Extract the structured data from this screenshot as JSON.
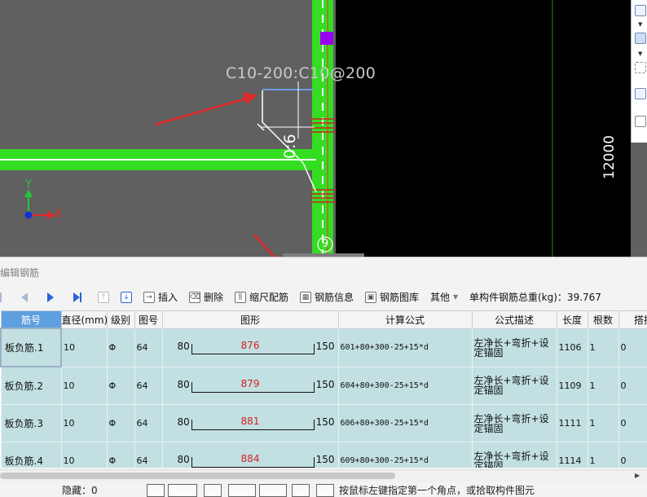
{
  "cad": {
    "rebar_label": "C10-200:C10@200",
    "length_label": "12000",
    "dim_label": "0:6",
    "grid_circle_label": "9",
    "axis_x": "X",
    "axis_y": "Y",
    "colors": {
      "beam": "#33dd22",
      "viewport_bg": "#606060",
      "black_area": "#000000",
      "rebar_red": "#cc2222",
      "arrow_red": "#e02828"
    }
  },
  "panel": {
    "title": "编辑钢筋",
    "toolbar": {
      "insert_label": "插入",
      "delete_label": "删除",
      "scale_label": "缩尺配筋",
      "rebar_info_label": "钢筋信息",
      "rebar_library_label": "钢筋图库",
      "other_label": "其他",
      "total_weight_label": "单构件钢筋总重(kg)：39.767"
    },
    "columns": [
      "筋号",
      "直径(mm)",
      "级别",
      "图号",
      "图形",
      "计算公式",
      "公式描述",
      "长度",
      "根数",
      "搭接"
    ],
    "rows": [
      {
        "name": "板负筋.1",
        "diameter": "10",
        "grade": "Φ",
        "fig": "64",
        "left": "80",
        "mid": "876",
        "right": "150",
        "formula": "601+80+300-25+15*d",
        "desc": "左净长+弯折+设定锚固",
        "length": "1106",
        "count": "1",
        "lap": "0"
      },
      {
        "name": "板负筋.2",
        "diameter": "10",
        "grade": "Φ",
        "fig": "64",
        "left": "80",
        "mid": "879",
        "right": "150",
        "formula": "604+80+300-25+15*d",
        "desc": "左净长+弯折+设定锚固",
        "length": "1109",
        "count": "1",
        "lap": "0"
      },
      {
        "name": "板负筋.3",
        "diameter": "10",
        "grade": "Φ",
        "fig": "64",
        "left": "80",
        "mid": "881",
        "right": "150",
        "formula": "606+80+300-25+15*d",
        "desc": "左净长+弯折+设定锚固",
        "length": "1111",
        "count": "1",
        "lap": "0"
      },
      {
        "name": "板负筋.4",
        "diameter": "10",
        "grade": "Φ",
        "fig": "64",
        "left": "80",
        "mid": "884",
        "right": "150",
        "formula": "609+80+300-25+15*d",
        "desc": "左净长+弯折+设定锚固",
        "length": "1114",
        "count": "1",
        "lap": "0"
      }
    ]
  },
  "status": {
    "hidden_label": "隐藏：0",
    "hint": "按鼠标左键指定第一个角点，或拾取构件图元"
  }
}
